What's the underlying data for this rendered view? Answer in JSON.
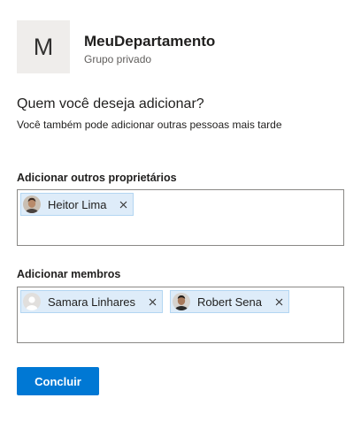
{
  "group": {
    "initial": "M",
    "name": "MeuDepartamento",
    "type": "Grupo privado"
  },
  "prompt": {
    "question": "Quem você deseja adicionar?",
    "hint": "Você também pode adicionar outras pessoas mais tarde"
  },
  "owners": {
    "label": "Adicionar outros proprietários",
    "people": [
      {
        "name": "Heitor Lima",
        "avatar": "photo-avatar"
      }
    ]
  },
  "members": {
    "label": "Adicionar membros",
    "people": [
      {
        "name": "Samara Linhares",
        "avatar": "placeholder-avatar"
      },
      {
        "name": "Robert Sena",
        "avatar": "photo-avatar"
      }
    ]
  },
  "actions": {
    "done_label": "Concluir"
  },
  "colors": {
    "accent": "#0078d4",
    "chip_background": "#deecf9",
    "chip_border": "#b3d6f2",
    "avatar_background": "#efedeb"
  }
}
